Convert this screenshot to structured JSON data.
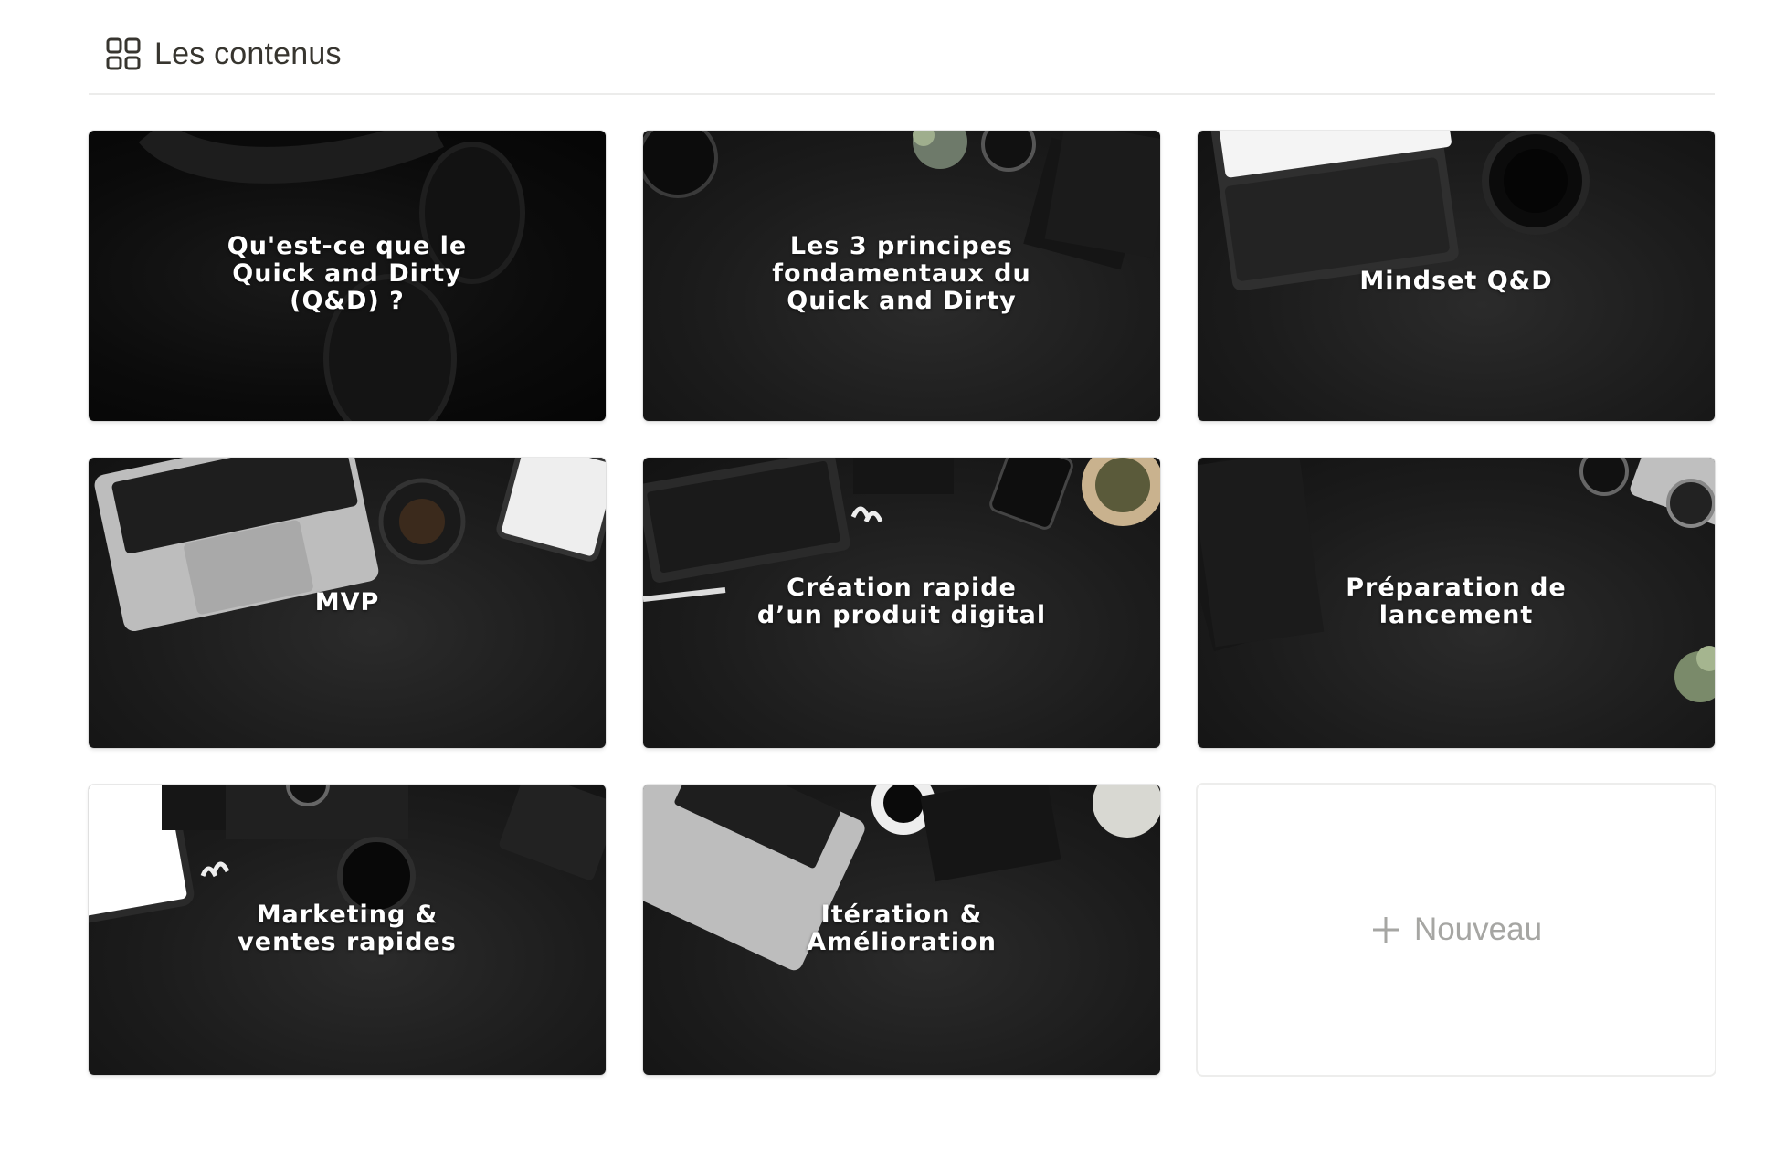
{
  "header": {
    "view_icon": "gallery-grid-icon",
    "view_label": "Les contenus"
  },
  "cards": [
    {
      "title": "Qu'est-ce que le\nQuick and Dirty\n(Q&D) ?",
      "cover": "headphones on dark desk"
    },
    {
      "title": "Les 3 principes\nfondamentaux du\nQuick and Dirty",
      "cover": "notebooks, coffee cup and plant on dark desk"
    },
    {
      "title": "Mindset Q&D",
      "cover": "tablet keyboard and coffee on dark desk"
    },
    {
      "title": "MVP",
      "cover": "laptop, coffee and tablet on dark desk"
    },
    {
      "title": "Création rapide\nd’un produit digital",
      "cover": "keyboard, earbuds, phone and plant on dark desk"
    },
    {
      "title": "Préparation de\nlancement",
      "cover": "notebook, camera and plant on dark desk"
    },
    {
      "title": "Marketing &\nventes rapides",
      "cover": "tablet, camera, earbuds and coffee on dark desk"
    },
    {
      "title": "Itération &\nAmélioration",
      "cover": "laptop, coffee and notebook on dark desk"
    }
  ],
  "new_card": {
    "icon": "plus-icon",
    "label": "Nouveau"
  }
}
